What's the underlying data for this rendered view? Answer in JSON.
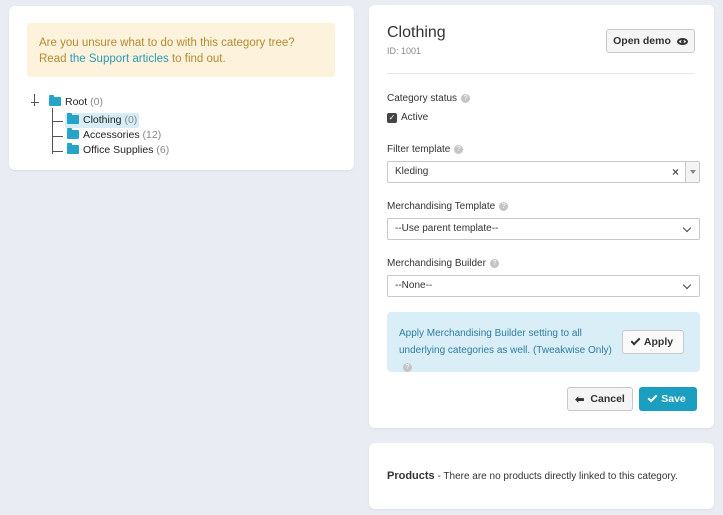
{
  "notice": {
    "line1": "Are you unsure what to do with this category tree? Read",
    "link": "the Support articles",
    "suffix": " to find out."
  },
  "tree": {
    "root": {
      "label": "Root",
      "count": "(0)"
    },
    "children": [
      {
        "label": "Clothing",
        "count": "(0)",
        "selected": true
      },
      {
        "label": "Accessories",
        "count": "(12)"
      },
      {
        "label": "Office Supplies",
        "count": "(6)"
      }
    ]
  },
  "detail": {
    "title": "Clothing",
    "id": "ID: 1001",
    "open_demo": "Open demo",
    "status_label": "Category status",
    "active_label": "Active",
    "filter_label": "Filter template",
    "filter_value": "Kleding",
    "merch_template_label": "Merchandising Template",
    "merch_template_value": "--Use parent template--",
    "merch_builder_label": "Merchandising Builder",
    "merch_builder_value": "--None--",
    "apply_info": "Apply Merchandising Builder setting to all underlying categories as well. (Tweakwise Only)",
    "apply_button": "Apply",
    "cancel_button": "Cancel",
    "save_button": "Save",
    "help_glyph": "?"
  },
  "products": {
    "title": "Products",
    "text": " - There are no products directly linked to this category."
  },
  "colors": {
    "accent": "#1b9fc0",
    "folder": "#27a3c8",
    "notice_bg": "#fdf3dd",
    "info_bg": "#d9eef7"
  }
}
